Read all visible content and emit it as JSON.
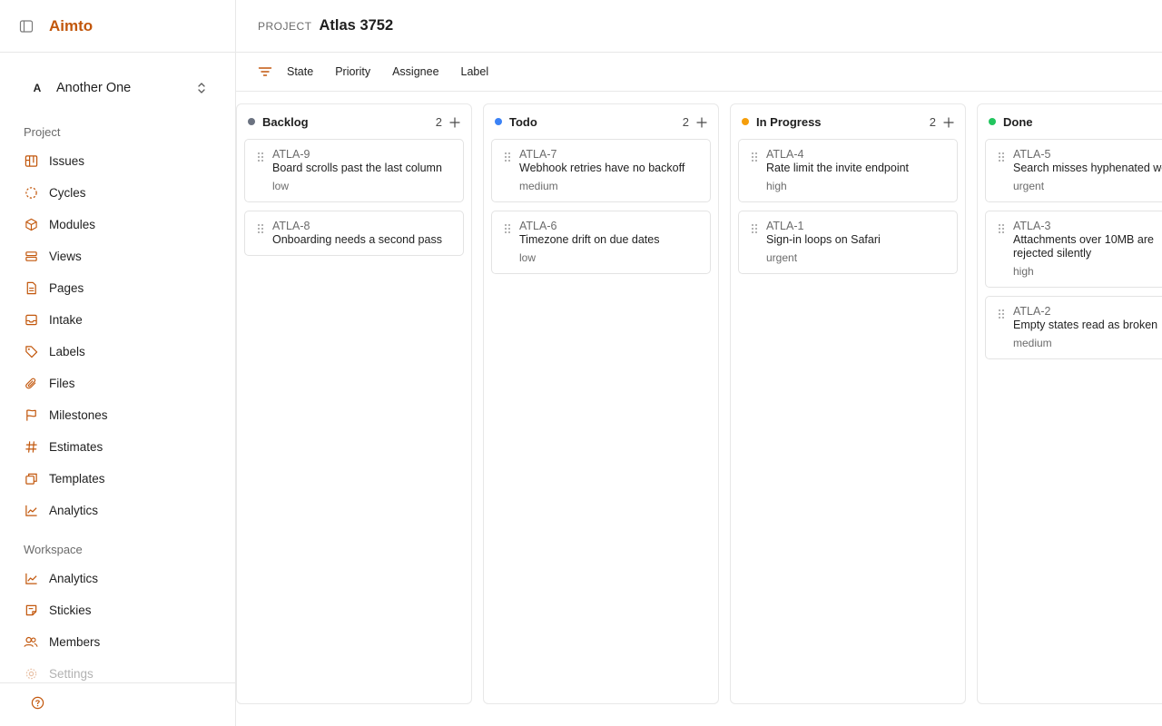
{
  "app": {
    "brand": "Aimto"
  },
  "workspace": {
    "avatar_letter": "A",
    "name": "Another One"
  },
  "sidebar": {
    "project_section": "Project",
    "project_items": [
      {
        "label": "Issues",
        "icon": "board-icon"
      },
      {
        "label": "Cycles",
        "icon": "cycle-icon"
      },
      {
        "label": "Modules",
        "icon": "cube-icon"
      },
      {
        "label": "Views",
        "icon": "layers-icon"
      },
      {
        "label": "Pages",
        "icon": "file-text-icon"
      },
      {
        "label": "Intake",
        "icon": "inbox-icon"
      },
      {
        "label": "Labels",
        "icon": "tag-icon"
      },
      {
        "label": "Files",
        "icon": "paperclip-icon"
      },
      {
        "label": "Milestones",
        "icon": "flag-icon"
      },
      {
        "label": "Estimates",
        "icon": "hash-icon"
      },
      {
        "label": "Templates",
        "icon": "copy-icon"
      },
      {
        "label": "Analytics",
        "icon": "chart-line-icon"
      }
    ],
    "workspace_section": "Workspace",
    "workspace_items": [
      {
        "label": "Analytics",
        "icon": "chart-line-icon"
      },
      {
        "label": "Stickies",
        "icon": "sticky-note-icon"
      },
      {
        "label": "Members",
        "icon": "users-icon"
      },
      {
        "label": "Settings",
        "icon": "gear-icon"
      }
    ]
  },
  "header": {
    "crumb_label": "PROJECT",
    "project_name": "Atlas 3752"
  },
  "filters": [
    "State",
    "Priority",
    "Assignee",
    "Label"
  ],
  "colors": {
    "accent": "#c2570c",
    "backlog": "#6b7280",
    "todo": "#3b82f6",
    "in_progress": "#f59e0b",
    "done": "#22c55e"
  },
  "columns": [
    {
      "name": "Backlog",
      "count": "2",
      "color": "#6b7280",
      "cards": [
        {
          "id": "ATLA-9",
          "title": "Board scrolls past the last column",
          "priority": "low"
        },
        {
          "id": "ATLA-8",
          "title": "Onboarding needs a second pass",
          "priority": ""
        }
      ]
    },
    {
      "name": "Todo",
      "count": "2",
      "color": "#3b82f6",
      "cards": [
        {
          "id": "ATLA-7",
          "title": "Webhook retries have no backoff",
          "priority": "medium"
        },
        {
          "id": "ATLA-6",
          "title": "Timezone drift on due dates",
          "priority": "low"
        }
      ]
    },
    {
      "name": "In Progress",
      "count": "2",
      "color": "#f59e0b",
      "cards": [
        {
          "id": "ATLA-4",
          "title": "Rate limit the invite endpoint",
          "priority": "high"
        },
        {
          "id": "ATLA-1",
          "title": "Sign-in loops on Safari",
          "priority": "urgent"
        }
      ]
    },
    {
      "name": "Done",
      "count": "",
      "color": "#22c55e",
      "cards": [
        {
          "id": "ATLA-5",
          "title": "Search misses hyphenated words",
          "priority": "urgent"
        },
        {
          "id": "ATLA-3",
          "title": "Attachments over 10MB are rejected silently",
          "priority": "high"
        },
        {
          "id": "ATLA-2",
          "title": "Empty states read as broken",
          "priority": "medium"
        }
      ]
    }
  ]
}
